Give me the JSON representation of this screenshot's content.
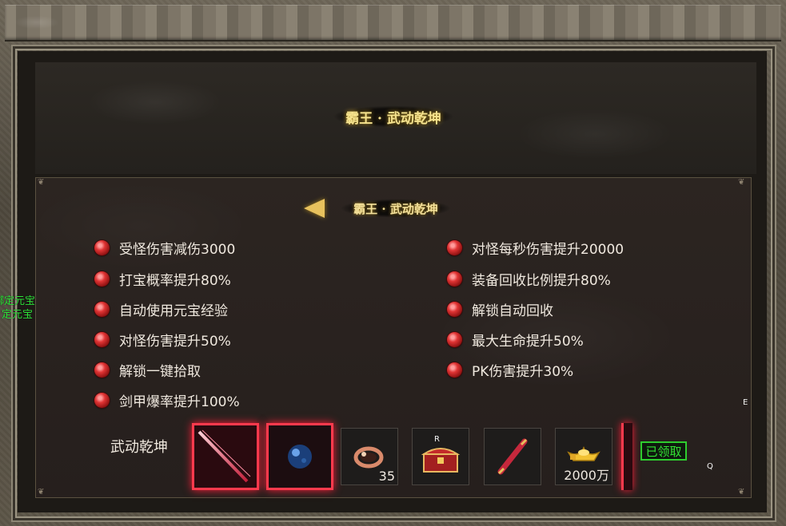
{
  "header": {
    "title": "霸王 · 武动乾坤"
  },
  "content": {
    "subtitle": "霸王 · 武动乾坤"
  },
  "attributes_left": [
    "受怪伤害减伤3000",
    "打宝概率提升80%",
    "自动使用元宝经验",
    "对怪伤害提升50%",
    "解锁一键拾取",
    "剑甲爆率提升100%"
  ],
  "attributes_right": [
    "对怪每秒伤害提升20000",
    "装备回收比例提升80%",
    "解锁自动回收",
    "最大生命提升50%",
    "PK伤害提升30%"
  ],
  "side_text": [
    "绑定元宝",
    "定元宝"
  ],
  "rewards": {
    "label": "武动乾坤",
    "items": [
      {
        "icon": "sword-icon",
        "count": ""
      },
      {
        "icon": "orb-icon",
        "count": ""
      },
      {
        "icon": "ring-icon",
        "count": "35"
      },
      {
        "icon": "chest-icon",
        "count": "",
        "badge": "R"
      },
      {
        "icon": "scroll-icon",
        "count": ""
      },
      {
        "icon": "gold-ingot-icon",
        "count": "2000万"
      }
    ],
    "status": "已领取"
  },
  "stray_marks": [
    "E",
    "Q"
  ]
}
